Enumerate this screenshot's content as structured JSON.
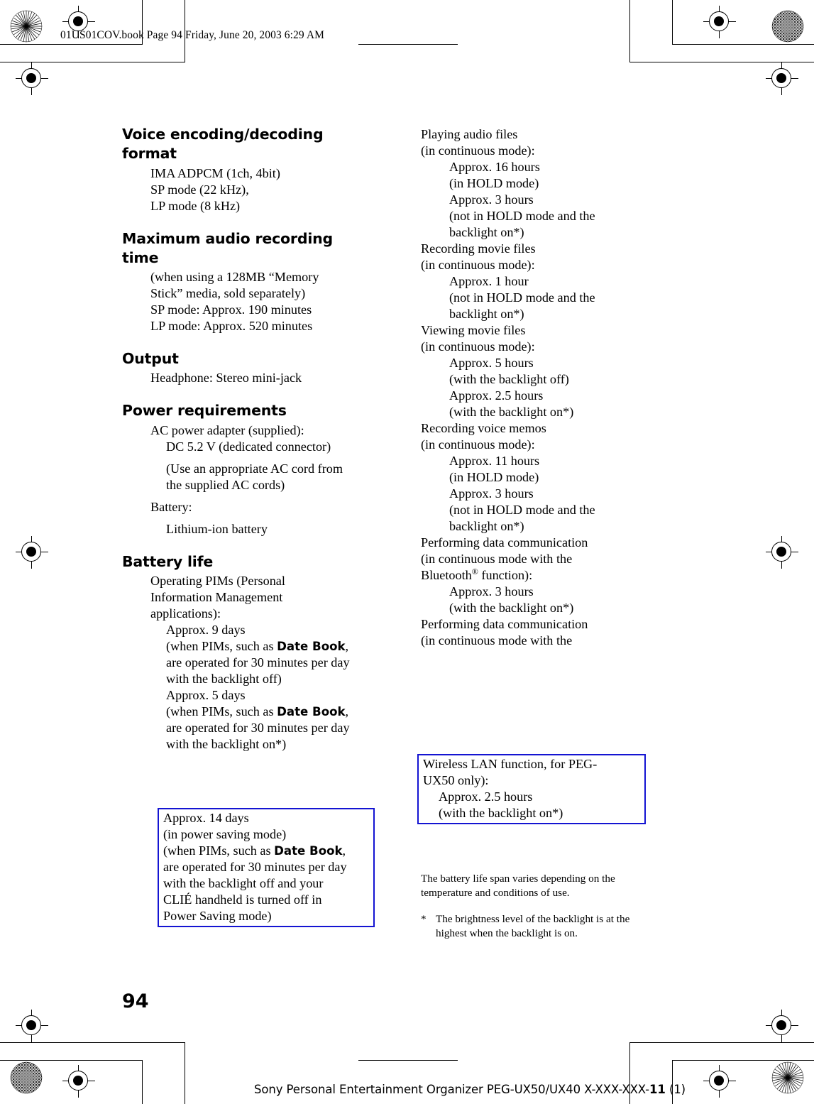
{
  "page": {
    "slug_line": "01US01COV.book  Page 94  Friday, June 20, 2003  6:29 AM",
    "page_number": "94",
    "footer": {
      "text_before": "Sony Personal Entertainment Organizer  PEG-UX50/UX40  X-XXX-XXX-",
      "bold_part": "11",
      "text_after": " (1)"
    },
    "highlight_color": "#1414d2"
  },
  "left_column": {
    "sections": [
      {
        "heading": "Voice encoding/decoding format",
        "lines": [
          "IMA ADPCM (1ch, 4bit)",
          "SP mode (22 kHz),",
          "LP mode (8 kHz)"
        ]
      },
      {
        "heading": "Maximum audio recording time",
        "lines": [
          "(when using a 128MB “Memory",
          "Stick” media, sold separately)",
          "SP mode: Approx. 190 minutes",
          "LP mode: Approx. 520 minutes"
        ]
      },
      {
        "heading": "Output",
        "lines": [
          "Headphone: Stereo mini-jack"
        ]
      },
      {
        "heading": "Power requirements",
        "lines": [
          "AC power adapter (supplied):",
          "DC 5.2 V (dedicated connector)",
          "(Use an appropriate AC cord from",
          "the supplied AC cords)",
          "Battery:",
          "Lithium-ion battery"
        ]
      },
      {
        "heading": "Battery life",
        "lines": [
          "Operating PIMs (Personal",
          "Information Management",
          "applications):"
        ]
      }
    ],
    "battery_life_entries": {
      "entry1_value": "Approx. 9 days",
      "entry1_cond_a": "(when PIMs, such as ",
      "entry1_app": "Date Book",
      "entry1_cond_b": ",",
      "entry1_cond_c": "are operated for 30 minutes per day",
      "entry1_cond_d": "with the backlight off)",
      "entry2_value": "Approx. 5 days",
      "entry2_cond_a": "(when PIMs, such as ",
      "entry2_app": "Date Book",
      "entry2_cond_b": ",",
      "entry2_cond_c": "are operated for 30 minutes per day",
      "entry2_cond_d": "with the backlight on*)"
    },
    "highlight_box": {
      "line1": "Approx. 14 days",
      "line2": "(in power saving mode)",
      "line3a": "(when PIMs, such as ",
      "line3app": "Date Book",
      "line3b": ",",
      "line4": "are operated for 30 minutes per day",
      "line5": "with the backlight off and your",
      "line6": "CLIÉ handheld is turned off in",
      "line7": "Power Saving mode)"
    }
  },
  "right_column": {
    "groups": [
      {
        "title_line1": "Playing audio files",
        "title_line2": "(in continuous mode):",
        "items": [
          {
            "value": "Approx. 16 hours",
            "cond": [
              "(in HOLD mode)"
            ]
          },
          {
            "value": "Approx. 3 hours",
            "cond": [
              "(not in HOLD mode and the",
              "backlight on*)"
            ]
          }
        ]
      },
      {
        "title_line1": "Recording movie files",
        "title_line2": "(in continuous mode):",
        "items": [
          {
            "value": "Approx. 1 hour",
            "cond": [
              "(not in HOLD mode and the",
              "backlight on*)"
            ]
          }
        ]
      },
      {
        "title_line1": "Viewing movie files",
        "title_line2": "(in continuous mode):",
        "items": [
          {
            "value": "Approx. 5 hours",
            "cond": [
              "(with the backlight off)"
            ]
          },
          {
            "value": "Approx. 2.5 hours",
            "cond": [
              "(with the backlight on*)"
            ]
          }
        ]
      },
      {
        "title_line1": "Recording voice memos",
        "title_line2": " (in continuous mode):",
        "items": [
          {
            "value": "Approx. 11 hours",
            "cond": [
              "(in HOLD mode)"
            ]
          },
          {
            "value": "Approx. 3 hours",
            "cond": [
              "(not in HOLD mode and the",
              "backlight on*)"
            ]
          }
        ]
      }
    ],
    "bluetooth_group": {
      "title_line1": "Performing data communication",
      "title_line2": "(in continuous mode with the",
      "title_line3_pre": "Bluetooth",
      "title_line3_sup": "®",
      "title_line3_post": " function):",
      "value": "Approx. 3 hours",
      "cond": "(with the backlight on*)"
    },
    "wlan_group": {
      "title_line1": "Performing data communication",
      "title_line2": "(in continuous mode with the"
    },
    "highlight_box": {
      "line1": "Wireless LAN function, for PEG-",
      "line2": "UX50 only):",
      "line3": "Approx. 2.5 hours",
      "line4": "(with the backlight on*)"
    },
    "notes": {
      "battery_note_line1": "The battery life span varies depending on",
      "battery_note_line2": "the temperature and conditions of use.",
      "star_symbol": "*",
      "star_note_line1": "The brightness level of the backlight is",
      "star_note_line2": "at the highest when the backlight is on."
    }
  }
}
